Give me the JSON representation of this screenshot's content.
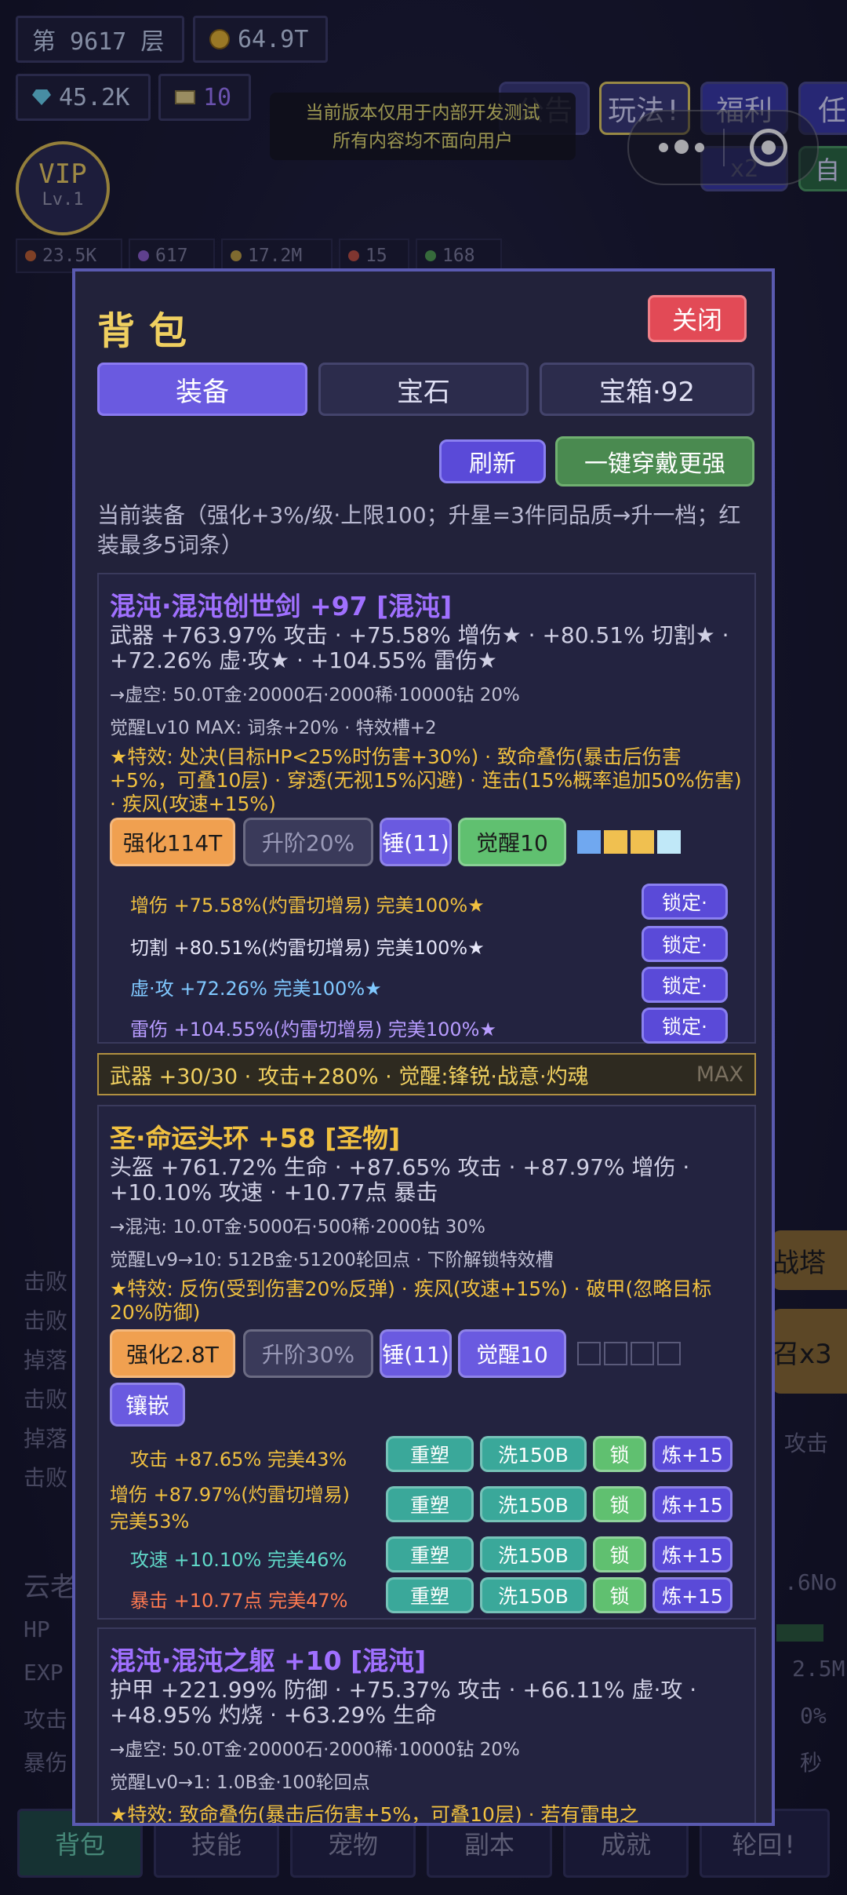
{
  "hud": {
    "floor": "第 9617 层",
    "gold": "64.9T",
    "diamond": "45.2K",
    "ticket": "10"
  },
  "top_buttons": [
    "公告",
    "玩法!",
    "福利",
    "任",
    "x2",
    "自"
  ],
  "notice": [
    "当前版本仅用于内部开发测试",
    "所有内容均不面向用户"
  ],
  "vip": {
    "title": "VIP",
    "level": "Lv.1"
  },
  "stats": [
    "23.5K",
    "617",
    "17.2M",
    "15",
    "168"
  ],
  "background_text": {
    "left_logs": [
      "击败",
      "击败",
      "掉落",
      "击败",
      "掉落",
      "击败"
    ],
    "right_buttons": [
      "战塔",
      "召x3"
    ],
    "right_texts": [
      "攻击",
      ".6No",
      "2.5M",
      "0%",
      "秒"
    ],
    "left_labels": [
      "云老",
      "HP",
      "EXP",
      "攻击",
      "暴伤"
    ]
  },
  "bottom_nav": [
    "背包",
    "技能",
    "宠物",
    "副本",
    "成就",
    "轮回!"
  ],
  "modal": {
    "title": "背包",
    "close": "关闭",
    "tabs": [
      "装备",
      "宝石",
      "宝箱·92"
    ],
    "refresh": "刷新",
    "equip_best": "一键穿戴更强",
    "intro": "当前装备（强化+3%/级·上限100；升星=3件同品质→升一档；红装最多5词条）",
    "item1": {
      "name": "混沌·混沌创世剑 +97 [混沌]",
      "stats": "武器  +763.97% 攻击 · +75.58% 增伤★ · +80.51% 切割★ · +72.26% 虚·攻★ · +104.55% 雷伤★",
      "cost": "→虚空: 50.0T金·20000石·2000稀·10000钻 20%",
      "awaken": "觉醒Lv10 MAX: 词条+20% · 特效槽+2",
      "special": "★特效: 处决(目标HP<25%时伤害+30%) · 致命叠伤(暴击后伤害+5%，可叠10层) · 穿透(无视15%闪避) · 连击(15%概率追加50%伤害) · 疾风(攻速+15%)",
      "btn_enhance": "强化114T",
      "btn_upgrade": "升阶20%",
      "btn_hammer": "锤(11)",
      "btn_awaken": "觉醒10",
      "affixes": [
        {
          "text": "增伤 +75.58%(灼雷切增易) 完美100%★",
          "color": "#f0c040",
          "lock": "锁定·"
        },
        {
          "text": "切割 +80.51%(灼雷切增易) 完美100%★",
          "color": "#e6e6f8",
          "lock": "锁定·"
        },
        {
          "text": "虚·攻 +72.26% 完美100%★",
          "color": "#80c8ff",
          "lock": "锁定·"
        },
        {
          "text": "雷伤 +104.55%(灼雷切增易) 完美100%★",
          "color": "#b89cff",
          "lock": "锁定·"
        }
      ]
    },
    "banner": {
      "text": "武器 +30/30 · 攻击+280% · 觉醒:锋锐·战意·灼魂",
      "max": "MAX"
    },
    "item2": {
      "name": "圣·命运头环 +58 [圣物]",
      "stats": "头盔  +761.72% 生命 · +87.65% 攻击 · +87.97% 增伤 · +10.10% 攻速 · +10.77点 暴击",
      "cost": "→混沌: 10.0T金·5000石·500稀·2000钻 30%",
      "awaken": "觉醒Lv9→10: 512B金·51200轮回点 · 下阶解锁特效槽",
      "special": "★特效: 反伤(受到伤害20%反弹) · 疾风(攻速+15%) · 破甲(忽略目标20%防御)",
      "btn_enhance": "强化2.8T",
      "btn_upgrade": "升阶30%",
      "btn_hammer": "锤(11)",
      "btn_awaken": "觉醒10",
      "btn_inlay": "镶嵌",
      "ops": {
        "reshape": "重塑",
        "wash": "洗150B",
        "lock": "锁",
        "refine": "炼+15"
      },
      "affixes": [
        {
          "text": "攻击 +87.65% 完美43%",
          "color": "#f0c040"
        },
        {
          "text": "增伤 +87.97%(灼雷切增易) 完美53%",
          "color": "#f0c040"
        },
        {
          "text": "攻速 +10.10% 完美46%",
          "color": "#60d8c8"
        },
        {
          "text": "暴击 +10.77点 完美47%",
          "color": "#ff7a50"
        }
      ]
    },
    "item3": {
      "name": "混沌·混沌之躯 +10 [混沌]",
      "stats": "护甲  +221.99% 防御 · +75.37% 攻击 · +66.11% 虚·攻 · +48.95% 灼烧 · +63.29% 生命",
      "cost": "→虚空: 50.0T金·20000石·2000稀·10000钻 20%",
      "awaken": "觉醒Lv0→1: 1.0B金·100轮回点",
      "special": "★特效: 致命叠伤(暴击后伤害+5%，可叠10层) · 若有雷电之"
    }
  }
}
